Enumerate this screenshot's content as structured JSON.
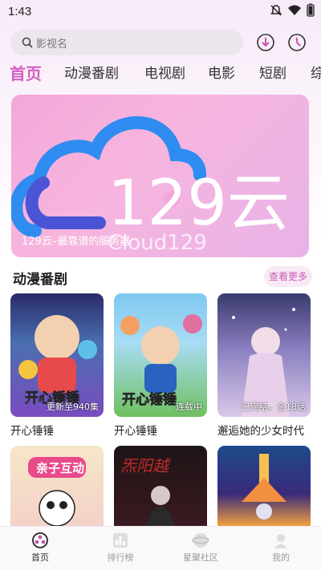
{
  "status_bar": {
    "time": "1:43"
  },
  "search": {
    "placeholder": "影视名"
  },
  "tabs": [
    "首页",
    "动漫番剧",
    "电视剧",
    "电影",
    "短剧",
    "综"
  ],
  "banner": {
    "logo_text": "129云",
    "logo_subtext": "Cloud129",
    "caption": "129云–最靠谱的服务器"
  },
  "section": {
    "title": "动漫番剧",
    "more_label": "查看更多"
  },
  "cards": [
    {
      "title": "开心锤锤",
      "badge": "更新至940集",
      "poster_text": "开心锤锤"
    },
    {
      "title": "开心锤锤",
      "badge": "连载中",
      "poster_text": "开心锤锤"
    },
    {
      "title": "邂逅她的少女时代",
      "badge": "已完结，全18话",
      "poster_text": ""
    }
  ],
  "cards_row2": [
    {
      "poster_text": "亲子互动"
    },
    {
      "poster_text": "炁阳越"
    },
    {
      "poster_text": ""
    }
  ],
  "bottom_nav": [
    {
      "label": "首页",
      "icon": "home-icon"
    },
    {
      "label": "排行榜",
      "icon": "ranking-icon"
    },
    {
      "label": "星聚社区",
      "icon": "community-icon"
    },
    {
      "label": "我的",
      "icon": "profile-icon"
    }
  ],
  "colors": {
    "accent": "#d35fc2",
    "banner_pink": "#f3a7d8",
    "cloud_blue": "#2f8cf0"
  }
}
